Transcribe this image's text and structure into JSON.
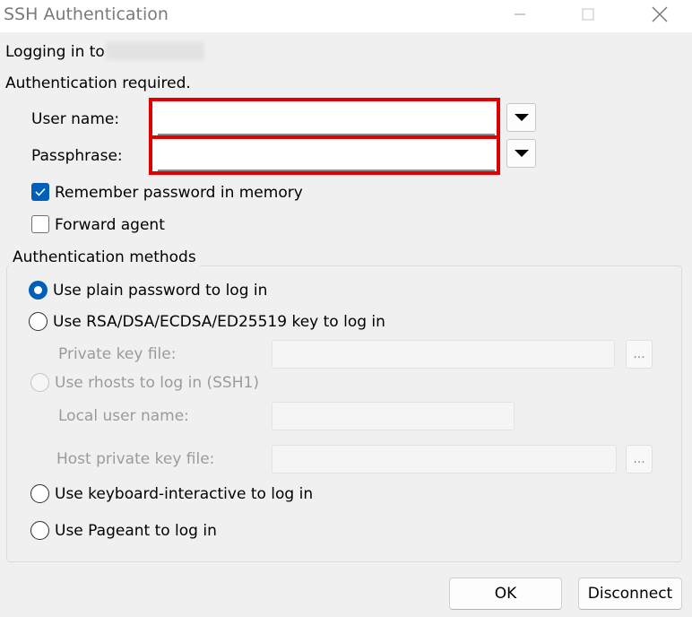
{
  "window": {
    "title": "SSH Authentication"
  },
  "header": {
    "logging_in_label": "Logging in to",
    "auth_required": "Authentication required."
  },
  "form": {
    "username_label": "User name:",
    "username_value": "",
    "passphrase_label": "Passphrase:",
    "passphrase_value": "",
    "remember_label": "Remember password in memory",
    "remember_checked": true,
    "forward_label": "Forward agent",
    "forward_checked": false
  },
  "methods": {
    "group_label": "Authentication methods",
    "plain_password": "Use plain password to log in",
    "rsa_key": "Use RSA/DSA/ECDSA/ED25519 key to log in",
    "private_key_label": "Private key file:",
    "rhosts": "Use rhosts to log in (SSH1)",
    "local_user_label": "Local user name:",
    "host_key_label": "Host private key file:",
    "keyboard_interactive": "Use keyboard-interactive to log in",
    "pageant": "Use Pageant to log in",
    "selected": "plain_password",
    "browse_label": "..."
  },
  "footer": {
    "ok_label": "OK",
    "disconnect_label": "Disconnect"
  },
  "colors": {
    "accent": "#005fb8",
    "highlight": "#e00000"
  }
}
